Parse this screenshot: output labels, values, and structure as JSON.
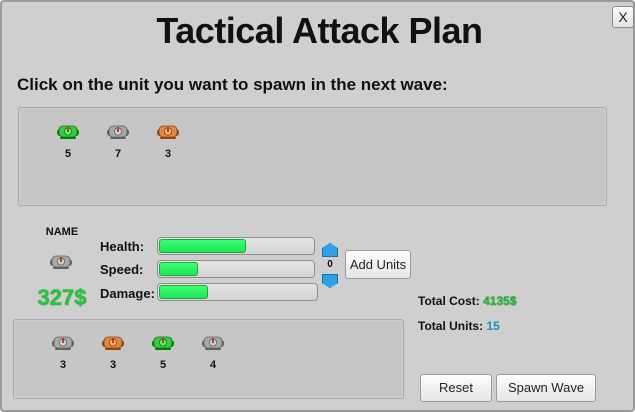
{
  "window": {
    "title": "Tactical Attack Plan",
    "close_label": "X",
    "instructions": "Click on the unit you want to spawn in the next wave:"
  },
  "available_units": [
    {
      "type": "green",
      "count": "5"
    },
    {
      "type": "gray",
      "count": "7"
    },
    {
      "type": "orange",
      "count": "3"
    }
  ],
  "selected_unit": {
    "name": "NAME",
    "type": "gray",
    "price": "327$",
    "stats": [
      {
        "label": "Health:",
        "fill": 0.57
      },
      {
        "label": "Speed:",
        "fill": 0.26
      },
      {
        "label": "Damage:",
        "fill": 0.32
      }
    ],
    "quantity": "0"
  },
  "buttons": {
    "add_units": "Add Units",
    "reset": "Reset",
    "spawn_wave": "Spawn Wave"
  },
  "totals": {
    "cost_label": "Total Cost:",
    "cost_value": "4135$",
    "units_label": "Total Units:",
    "units_value": "15"
  },
  "wave_units": [
    {
      "type": "gray",
      "count": "3"
    },
    {
      "type": "orange",
      "count": "3"
    },
    {
      "type": "green",
      "count": "5"
    },
    {
      "type": "gray",
      "count": "4"
    }
  ],
  "colors": {
    "green": "#3fc64a",
    "gray": "#a8a8a8",
    "orange": "#d98a4a",
    "accent_green": "#25c83a",
    "accent_blue": "#1f8fb8"
  }
}
